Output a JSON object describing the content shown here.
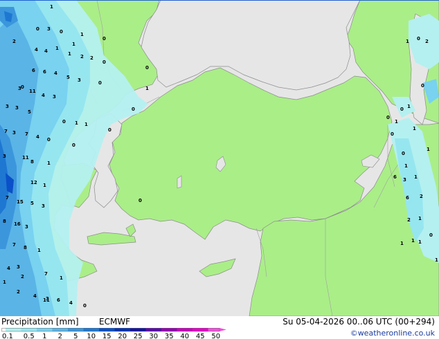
{
  "footer": {
    "title": "Precipitation [mm]",
    "model": "ECMWF",
    "validity": "Su 05-04-2026 00..06 UTC (00+294)",
    "credit": "©weatheronline.co.uk"
  },
  "legend": {
    "ticks": [
      "0.1",
      "0.5",
      "1",
      "2",
      "5",
      "10",
      "15",
      "20",
      "25",
      "30",
      "35",
      "40",
      "45",
      "50"
    ],
    "colors": [
      "#b4f0f0",
      "#96e6f0",
      "#78d2f0",
      "#5ab4e6",
      "#3c96dc",
      "#1e78d2",
      "#0a50c8",
      "#0032b4",
      "#1414a0",
      "#5a0aaa",
      "#9600b4",
      "#c800be",
      "#e600c8",
      "#f050dc"
    ]
  },
  "map_colors": {
    "sea": "#e6e6e6",
    "land": "#aaee88",
    "coast": "#8c8c8c",
    "border": "#a0a0a0"
  },
  "precip_values": [
    {
      "v": "1"
    },
    {
      "v": "0"
    },
    {
      "v": "3"
    },
    {
      "v": "0"
    },
    {
      "v": "2"
    },
    {
      "v": "4"
    },
    {
      "v": "4"
    },
    {
      "v": "1"
    },
    {
      "v": "1"
    },
    {
      "v": "2"
    },
    {
      "v": "6"
    },
    {
      "v": "6"
    },
    {
      "v": "4"
    },
    {
      "v": "5"
    },
    {
      "v": "3"
    },
    {
      "v": "0"
    },
    {
      "v": "3"
    },
    {
      "v": "11"
    },
    {
      "v": "4"
    },
    {
      "v": "3"
    },
    {
      "v": "3"
    },
    {
      "v": "3"
    },
    {
      "v": "5"
    },
    {
      "v": "0"
    },
    {
      "v": "1"
    },
    {
      "v": "7"
    },
    {
      "v": "3"
    },
    {
      "v": "7"
    },
    {
      "v": "4"
    },
    {
      "v": "0"
    },
    {
      "v": "3"
    },
    {
      "v": "11"
    },
    {
      "v": "8"
    },
    {
      "v": "1"
    },
    {
      "v": "12"
    },
    {
      "v": "1"
    },
    {
      "v": "7"
    },
    {
      "v": "15"
    },
    {
      "v": "5"
    },
    {
      "v": "3"
    },
    {
      "v": "8"
    },
    {
      "v": "16"
    },
    {
      "v": "3"
    },
    {
      "v": "7"
    },
    {
      "v": "8"
    },
    {
      "v": "1"
    },
    {
      "v": "3"
    },
    {
      "v": "4"
    },
    {
      "v": "1"
    },
    {
      "v": "2"
    },
    {
      "v": "4"
    },
    {
      "v": "3"
    },
    {
      "v": "1"
    },
    {
      "v": "2"
    },
    {
      "v": "7"
    },
    {
      "v": "11"
    },
    {
      "v": "6"
    },
    {
      "v": "4"
    },
    {
      "v": "0"
    },
    {
      "v": "1"
    },
    {
      "v": "1"
    },
    {
      "v": "0"
    },
    {
      "v": "2"
    },
    {
      "v": "0"
    },
    {
      "v": "0"
    },
    {
      "v": "0"
    },
    {
      "v": "0"
    },
    {
      "v": "0"
    },
    {
      "v": "1"
    },
    {
      "v": "0"
    },
    {
      "v": "0"
    },
    {
      "v": "1"
    },
    {
      "v": "1"
    },
    {
      "v": "0"
    },
    {
      "v": "2"
    },
    {
      "v": "0"
    },
    {
      "v": "0"
    },
    {
      "v": "1"
    },
    {
      "v": "0"
    },
    {
      "v": "0"
    },
    {
      "v": "1"
    },
    {
      "v": "1"
    },
    {
      "v": "6"
    },
    {
      "v": "3"
    },
    {
      "v": "1"
    },
    {
      "v": "2"
    },
    {
      "v": "6"
    },
    {
      "v": "1"
    },
    {
      "v": "2"
    },
    {
      "v": "1"
    },
    {
      "v": "1"
    },
    {
      "v": "1"
    },
    {
      "v": "1"
    },
    {
      "v": "0"
    },
    {
      "v": "1"
    },
    {
      "v": "1"
    },
    {
      "v": "0"
    }
  ]
}
